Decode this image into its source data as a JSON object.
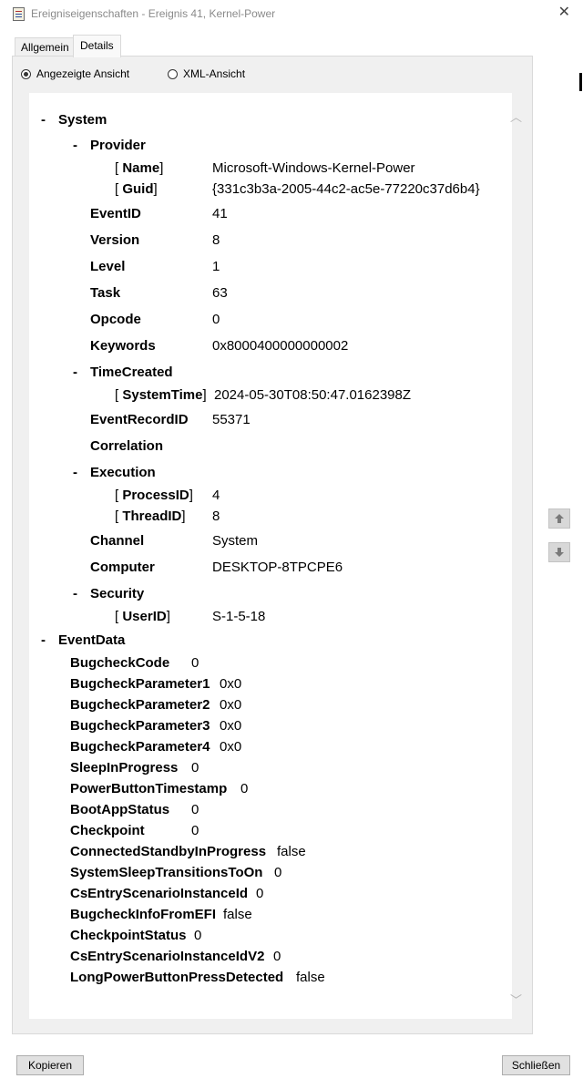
{
  "window": {
    "title": "Ereigniseigenschaften - Ereignis 41, Kernel-Power",
    "close_glyph": "✕"
  },
  "tabs": [
    {
      "label": "Allgemein"
    },
    {
      "label": "Details"
    }
  ],
  "view_options": [
    {
      "label": "Angezeigte Ansicht",
      "selected": true
    },
    {
      "label": "XML-Ansicht",
      "selected": false
    }
  ],
  "tree": {
    "system_label": "System",
    "provider": {
      "label": "Provider",
      "name_key": "Name",
      "name_value": "Microsoft-Windows-Kernel-Power",
      "guid_key": "Guid",
      "guid_value": "{331c3b3a-2005-44c2-ac5e-77220c37d6b4}"
    },
    "fields": [
      {
        "key": "EventID",
        "value": "41"
      },
      {
        "key": "Version",
        "value": "8"
      },
      {
        "key": "Level",
        "value": "1"
      },
      {
        "key": "Task",
        "value": "63"
      },
      {
        "key": "Opcode",
        "value": "0"
      },
      {
        "key": "Keywords",
        "value": "0x8000400000000002"
      }
    ],
    "time_created": {
      "label": "TimeCreated",
      "key": "SystemTime",
      "value": "2024-05-30T08:50:47.0162398Z"
    },
    "event_record_id": {
      "key": "EventRecordID",
      "value": "55371"
    },
    "correlation": {
      "key": "Correlation"
    },
    "execution": {
      "label": "Execution",
      "process_key": "ProcessID",
      "process_value": "4",
      "thread_key": "ThreadID",
      "thread_value": "8"
    },
    "channel": {
      "key": "Channel",
      "value": "System"
    },
    "computer": {
      "key": "Computer",
      "value": "DESKTOP-8TPCPE6"
    },
    "security": {
      "label": "Security",
      "key": "UserID",
      "value": "S-1-5-18"
    },
    "event_data_label": "EventData",
    "event_data": [
      {
        "key": "BugcheckCode",
        "value": "0"
      },
      {
        "key": "BugcheckParameter1",
        "value": "0x0"
      },
      {
        "key": "BugcheckParameter2",
        "value": "0x0"
      },
      {
        "key": "BugcheckParameter3",
        "value": "0x0"
      },
      {
        "key": "BugcheckParameter4",
        "value": "0x0"
      },
      {
        "key": "SleepInProgress",
        "value": "0"
      },
      {
        "key": "PowerButtonTimestamp",
        "value": "0"
      },
      {
        "key": "BootAppStatus",
        "value": "0"
      },
      {
        "key": "Checkpoint",
        "value": "0"
      },
      {
        "key": "ConnectedStandbyInProgress",
        "value": "false"
      },
      {
        "key": "SystemSleepTransitionsToOn",
        "value": "0"
      },
      {
        "key": "CsEntryScenarioInstanceId",
        "value": "0"
      },
      {
        "key": "BugcheckInfoFromEFI",
        "value": "false"
      },
      {
        "key": "CheckpointStatus",
        "value": "0"
      },
      {
        "key": "CsEntryScenarioInstanceIdV2",
        "value": "0"
      },
      {
        "key": "LongPowerButtonPressDetected",
        "value": "false"
      }
    ]
  },
  "buttons": {
    "copy": "Kopieren",
    "close": "Schließen"
  }
}
